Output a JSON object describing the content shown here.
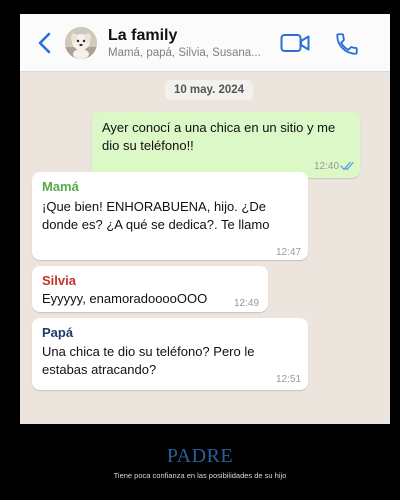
{
  "header": {
    "title": "La family",
    "subtitle": "Mamá, papá, Silvia, Susana..."
  },
  "date_label": "10 may. 2024",
  "messages": [
    {
      "direction": "out",
      "sender": "",
      "text_lines": [
        "Ayer conocí a una chica en un sitio y me",
        "dio su teléfono!!"
      ],
      "time": "12:40",
      "status": "read"
    },
    {
      "direction": "in",
      "sender": "Mamá",
      "text_lines": [
        "¡Que bien! ENHORABUENA, hijo. ¿De",
        "donde es? ¿A qué se dedica?. Te llamo"
      ],
      "time": "12:47"
    },
    {
      "direction": "in",
      "sender": "Silvia",
      "text_lines": [
        "Eyyyyy, enamoradooooOOO"
      ],
      "time": "12:49"
    },
    {
      "direction": "in",
      "sender": "Papá",
      "text_lines": [
        "Una chica te dio su teléfono? Pero le",
        "estabas atracando?"
      ],
      "time": "12:51"
    }
  ],
  "sender_colors": {
    "Mamá": "#5aa84a",
    "Silvia": "#c4332c",
    "Papá": "#1e3a6e"
  },
  "icons": {
    "back": "chevron-left-icon",
    "avatar": "group-avatar",
    "video": "video-camera-icon",
    "call": "phone-icon",
    "read": "double-check-icon"
  },
  "caption": {
    "title": "PADRE",
    "subtitle": "Tiene poca confianza en las posibilidades de su hijo"
  }
}
